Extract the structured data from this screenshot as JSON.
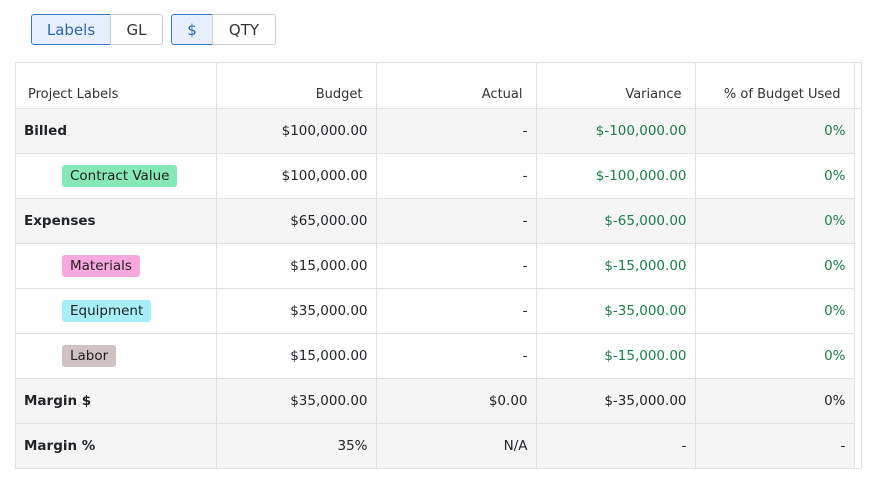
{
  "toggles": {
    "view": [
      "Labels",
      "GL"
    ],
    "unit": [
      "$",
      "QTY"
    ],
    "active_view": "Labels",
    "active_unit": "$"
  },
  "table": {
    "columns": [
      "Project Labels",
      "Budget",
      "Actual",
      "Variance",
      "% of Budget Used"
    ],
    "rows": [
      {
        "label": "Billed",
        "kind": "group",
        "budget": "$100,000.00",
        "actual": "-",
        "variance": "$-100,000.00",
        "pct": "0%",
        "green": true
      },
      {
        "label": "Contract Value",
        "kind": "tag",
        "tag_color": "#86e8b6",
        "budget": "$100,000.00",
        "actual": "-",
        "variance": "$-100,000.00",
        "pct": "0%",
        "green": true
      },
      {
        "label": "Expenses",
        "kind": "group",
        "budget": "$65,000.00",
        "actual": "-",
        "variance": "$-65,000.00",
        "pct": "0%",
        "green": true
      },
      {
        "label": "Materials",
        "kind": "tag",
        "tag_color": "#f7a8dc",
        "budget": "$15,000.00",
        "actual": "-",
        "variance": "$-15,000.00",
        "pct": "0%",
        "green": true
      },
      {
        "label": "Equipment",
        "kind": "tag",
        "tag_color": "#a6eef8",
        "budget": "$35,000.00",
        "actual": "-",
        "variance": "$-35,000.00",
        "pct": "0%",
        "green": true
      },
      {
        "label": "Labor",
        "kind": "tag",
        "tag_color": "#cfc2c0",
        "budget": "$15,000.00",
        "actual": "-",
        "variance": "$-15,000.00",
        "pct": "0%",
        "green": true
      },
      {
        "label": "Margin $",
        "kind": "group",
        "budget": "$35,000.00",
        "actual": "$0.00",
        "variance": "$-35,000.00",
        "pct": "0%",
        "green": false
      },
      {
        "label": "Margin %",
        "kind": "group",
        "budget": "35%",
        "actual": "N/A",
        "variance": "-",
        "pct": "-",
        "green": false
      }
    ]
  }
}
